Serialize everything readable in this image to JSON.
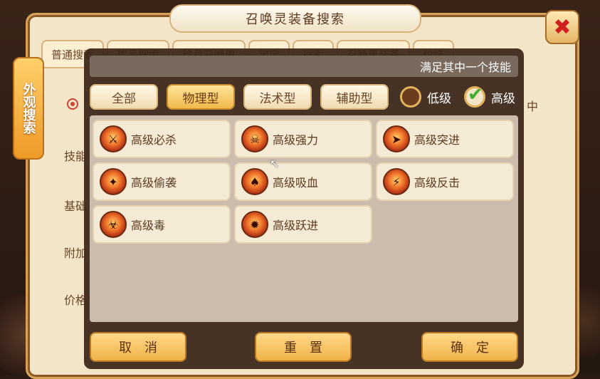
{
  "window": {
    "title": "召唤灵装备搜索",
    "close_label": "✖"
  },
  "base_tabs": [
    "普通搜索",
    "珍品搜索",
    "珍品召唤兽",
    "宝宝",
    "搜索",
    "召唤灵装备",
    "纹饰"
  ],
  "side_tab": {
    "label": "外观搜索"
  },
  "base_labels": {
    "skill": "技能",
    "basic": "基础",
    "extra": "附加",
    "price": "价格",
    "right_text": "中"
  },
  "modal": {
    "header": "满足其中一个技能",
    "filters": [
      {
        "label": "全部",
        "active": false
      },
      {
        "label": "物理型",
        "active": true
      },
      {
        "label": "法术型",
        "active": false
      },
      {
        "label": "辅助型",
        "active": false
      }
    ],
    "levels": [
      {
        "label": "低级",
        "checked": false
      },
      {
        "label": "高级",
        "checked": true
      }
    ],
    "skills": [
      {
        "name": "高级必杀",
        "icon": "slash-icon"
      },
      {
        "name": "高级强力",
        "icon": "demon-icon"
      },
      {
        "name": "高级突进",
        "icon": "dash-icon"
      },
      {
        "name": "高级偷袭",
        "icon": "ambush-icon"
      },
      {
        "name": "高级吸血",
        "icon": "bat-icon"
      },
      {
        "name": "高级反击",
        "icon": "counter-icon"
      },
      {
        "name": "高级毒",
        "icon": "poison-icon"
      },
      {
        "name": "高级跃进",
        "icon": "leap-icon"
      }
    ],
    "buttons": {
      "cancel": "取消",
      "reset": "重置",
      "confirm": "确定"
    }
  },
  "colors": {
    "accent": "#f0b94b",
    "panel": "#372418",
    "checked": "#3fae2e"
  }
}
